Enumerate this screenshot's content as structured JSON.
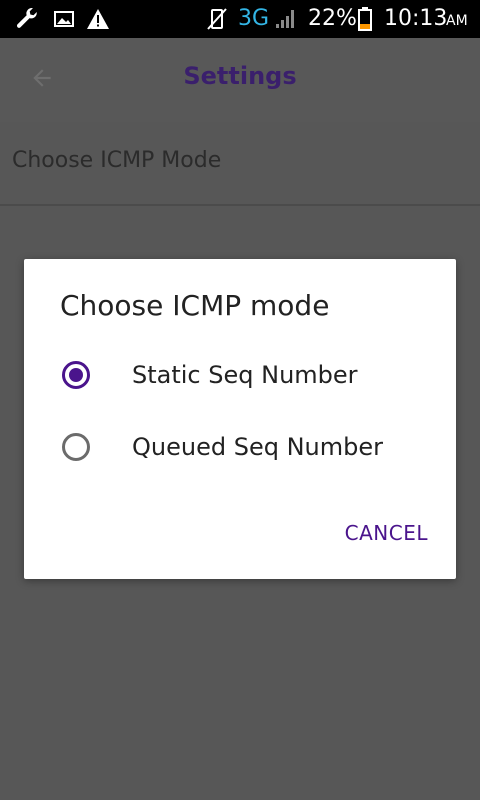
{
  "status_bar": {
    "icons_left": [
      "wrench-icon",
      "image-icon",
      "warning-icon"
    ],
    "network": "3G",
    "battery": "22%",
    "time": "10:13",
    "ampm": "AM"
  },
  "app_bar": {
    "title": "Settings",
    "back_icon": "back-arrow-icon",
    "title_color": "#3a1f6c"
  },
  "preference": {
    "title": "Choose ICMP Mode"
  },
  "dialog": {
    "title": "Choose ICMP mode",
    "options": [
      {
        "label": "Static Seq Number",
        "selected": true
      },
      {
        "label": "Queued Seq Number",
        "selected": false
      }
    ],
    "cancel_label": "CANCEL",
    "accent": "#4a148c"
  }
}
